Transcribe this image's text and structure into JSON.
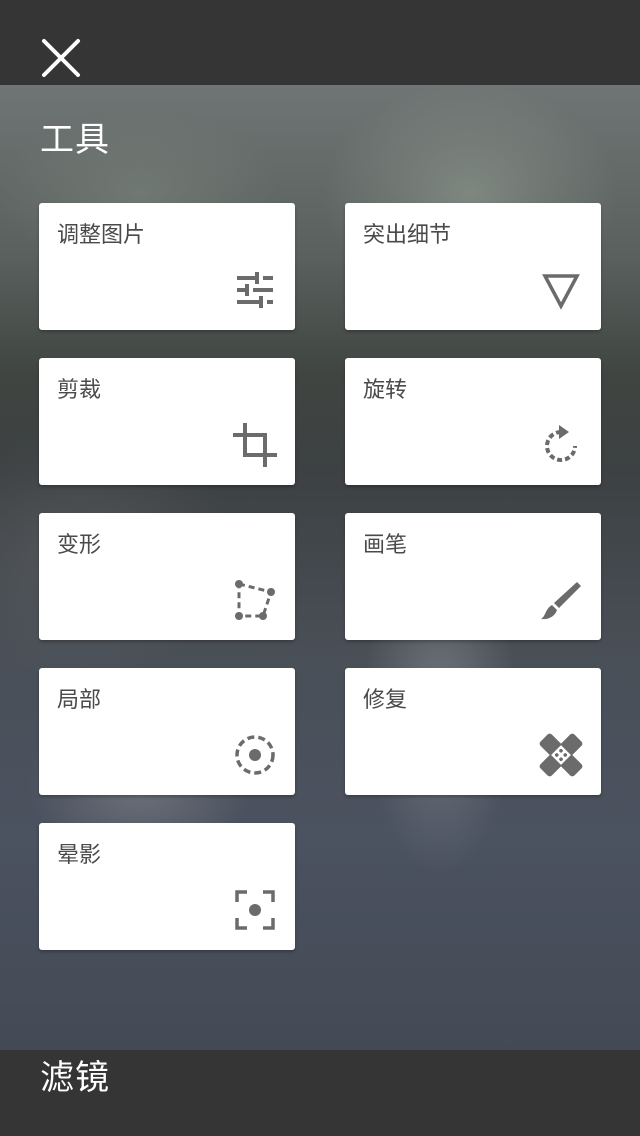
{
  "header": {
    "close_icon": "close-icon"
  },
  "tools_section": {
    "title": "工具",
    "items": [
      {
        "label": "调整图片",
        "icon": "tune-sliders-icon"
      },
      {
        "label": "突出细节",
        "icon": "triangle-down-icon"
      },
      {
        "label": "剪裁",
        "icon": "crop-icon"
      },
      {
        "label": "旋转",
        "icon": "rotate-icon"
      },
      {
        "label": "变形",
        "icon": "perspective-icon"
      },
      {
        "label": "画笔",
        "icon": "brush-icon"
      },
      {
        "label": "局部",
        "icon": "selective-target-icon"
      },
      {
        "label": "修复",
        "icon": "healing-bandage-icon"
      },
      {
        "label": "晕影",
        "icon": "vignette-focus-icon"
      }
    ]
  },
  "filters_section": {
    "title": "滤镜"
  },
  "colors": {
    "bar_background": "#353535",
    "card_background": "#ffffff",
    "card_text": "#4a4a4a",
    "icon_color": "#6b6b6b"
  }
}
